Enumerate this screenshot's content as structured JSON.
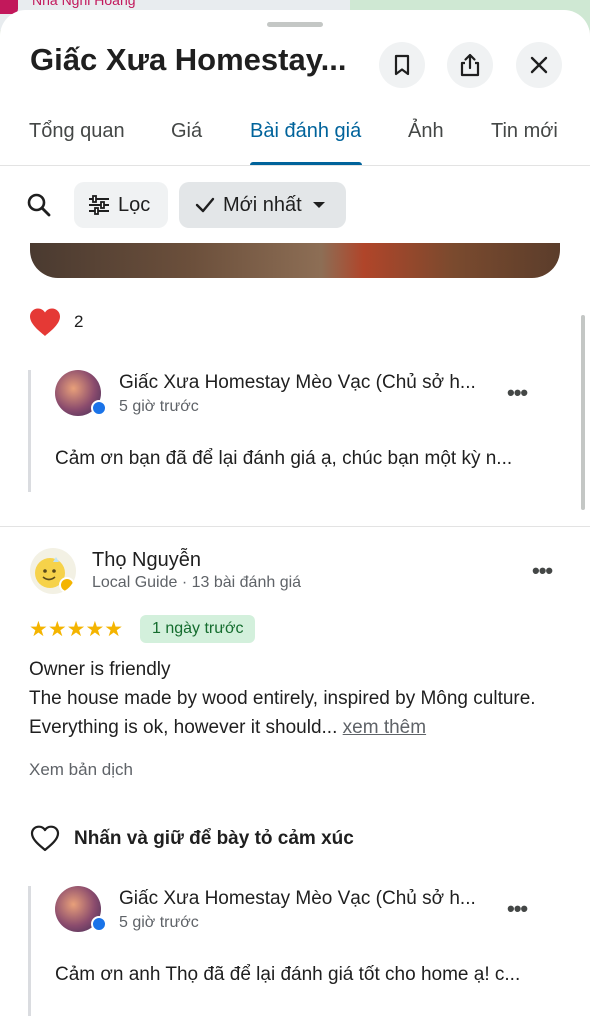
{
  "map": {
    "label": "Nhà Nghỉ Hoàng"
  },
  "header": {
    "title": "Giấc Xưa Homestay..."
  },
  "header_icons": {
    "bookmark": "bookmark-icon",
    "share": "share-icon",
    "close": "close-icon"
  },
  "tabs": [
    {
      "label": "Tổng quan"
    },
    {
      "label": "Giá"
    },
    {
      "label": "Bài đánh giá",
      "active": true
    },
    {
      "label": "Ảnh"
    },
    {
      "label": "Tin mới"
    }
  ],
  "filters": {
    "filter_label": "Lọc",
    "sort_label": "Mới nhất"
  },
  "first_review": {
    "reaction_count": "2",
    "reply": {
      "owner": "Giấc Xưa Homestay Mèo Vạc (Chủ sở h...",
      "time": "5 giờ trước",
      "text": "Cảm ơn bạn đã để lại đánh giá ạ, chúc bạn một kỳ n..."
    }
  },
  "second_review": {
    "name": "Thọ Nguyễn",
    "subtitle": "Local Guide · 13 bài đánh giá",
    "rating": 5,
    "stars": "★★★★★",
    "date_badge": "1 ngày trước",
    "line1": "Owner is friendly",
    "line2": "The house made by wood entirely, inspired by Mông culture. Everything is ok, however it should...",
    "more_link": "xem thêm",
    "translate": "Xem bản dịch",
    "react_prompt": "Nhấn và giữ để bày tỏ cảm xúc",
    "reply": {
      "owner": "Giấc Xưa Homestay Mèo Vạc (Chủ sở h...",
      "time": "5 giờ trước",
      "text": "Cảm ơn anh Thọ đã để lại đánh giá tốt cho home ạ! c..."
    }
  },
  "colors": {
    "accent": "#00639b",
    "star": "#f4b400",
    "badge_bg": "#d3f0dc",
    "badge_text": "#146c2e",
    "heart": "#e53935"
  }
}
